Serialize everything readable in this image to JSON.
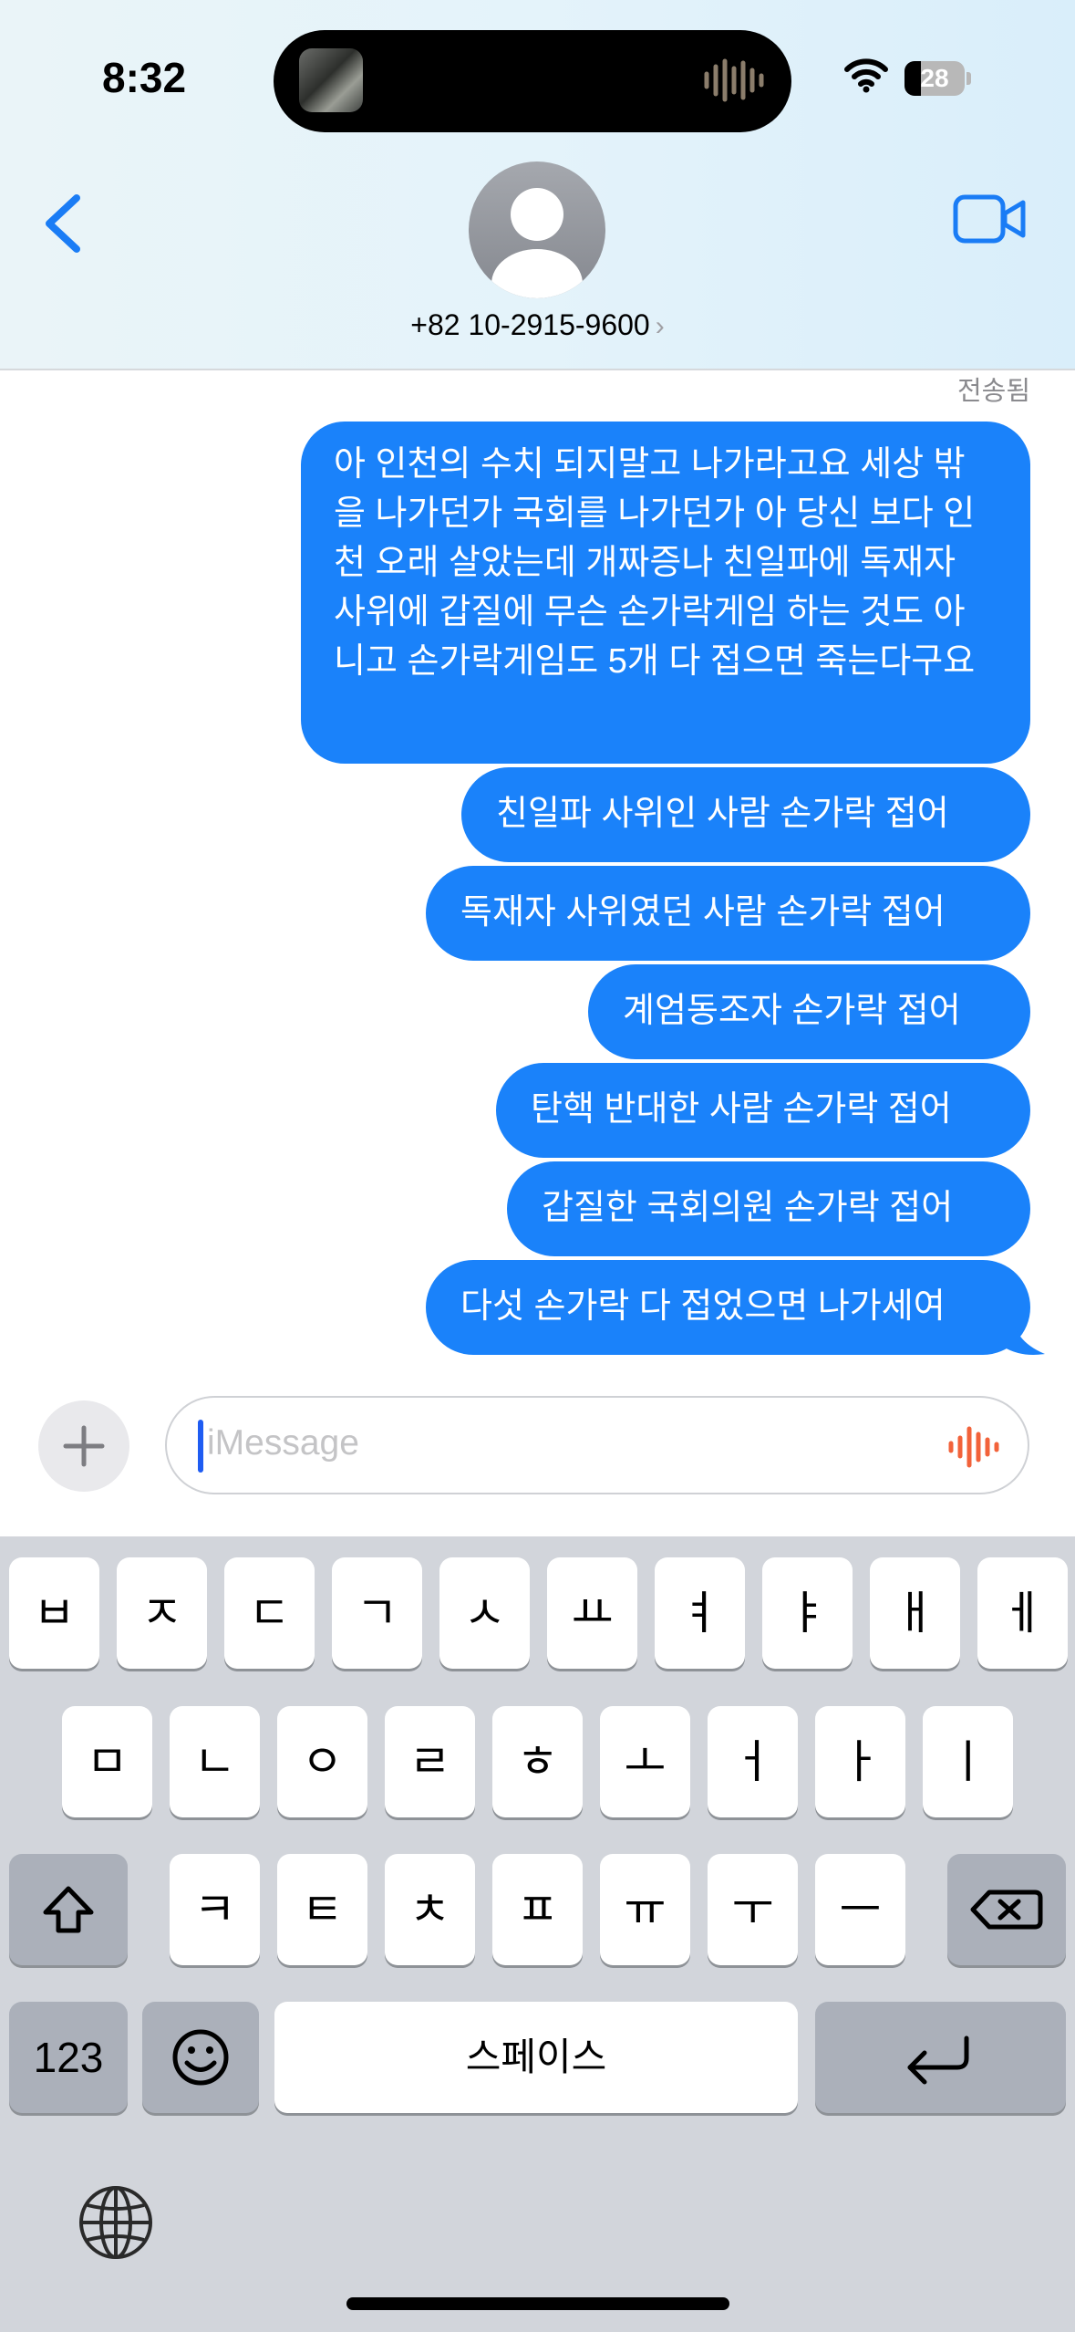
{
  "status_bar": {
    "time": "8:32",
    "battery_level": "28",
    "battery_fraction": 0.28,
    "icons": [
      "wifi-icon",
      "battery-icon"
    ]
  },
  "dynamic_island": {
    "icons": [
      "album-art",
      "audio-waveform-icon"
    ]
  },
  "header": {
    "back_icon": "chevron-left-icon",
    "video_icon": "video-camera-icon",
    "avatar_icon": "person-placeholder-icon",
    "contact_number": "+82 10-2915-9600",
    "contact_chevron": "›"
  },
  "conversation": {
    "delivery_status": "전송됨",
    "messages": [
      {
        "from": "me",
        "text": "아 인천의 수치 되지말고 나가라고요 세상 밖을 나가던가 국회를 나가던가 아 당신 보다 인천 오래 살았는데 개짜증나 친일파에 독재자 사위에 갑질에 무슨 손가락게임 하는 것도 아니고 손가락게임도 5개 다 접으면 죽는다구요"
      },
      {
        "from": "me",
        "text": "친일파 사위인 사람 손가락 접어"
      },
      {
        "from": "me",
        "text": "독재자 사위였던 사람 손가락 접어"
      },
      {
        "from": "me",
        "text": "계엄동조자 손가락 접어"
      },
      {
        "from": "me",
        "text": "탄핵 반대한 사람 손가락 접어"
      },
      {
        "from": "me",
        "text": "갑질한 국회의원 손가락 접어"
      },
      {
        "from": "me",
        "text": "다섯 손가락 다 접었으면 나가세여"
      }
    ]
  },
  "composer": {
    "plus_icon": "plus-icon",
    "placeholder": "iMessage",
    "audio_icon": "audio-waveform-icon"
  },
  "keyboard": {
    "row1": [
      "ㅂ",
      "ㅈ",
      "ㄷ",
      "ㄱ",
      "ㅅ",
      "ㅛ",
      "ㅕ",
      "ㅑ",
      "ㅐ",
      "ㅔ"
    ],
    "row2": [
      "ㅁ",
      "ㄴ",
      "ㅇ",
      "ㄹ",
      "ㅎ",
      "ㅗ",
      "ㅓ",
      "ㅏ",
      "ㅣ"
    ],
    "row3": [
      "ㅋ",
      "ㅌ",
      "ㅊ",
      "ㅍ",
      "ㅠ",
      "ㅜ",
      "ㅡ"
    ],
    "numbers_key": "123",
    "space_key": "스페이스",
    "icons": [
      "shift-icon",
      "delete-icon",
      "emoji-icon",
      "return-icon",
      "globe-icon"
    ]
  },
  "colors": {
    "bubble_blue": "#1a82fa",
    "accent_blue": "#1a7cf5",
    "keyboard_bg": "#d2d5db",
    "function_key": "#abb0ba",
    "cursor": "#1f5cf2",
    "audio_icon": "#f2623a"
  }
}
